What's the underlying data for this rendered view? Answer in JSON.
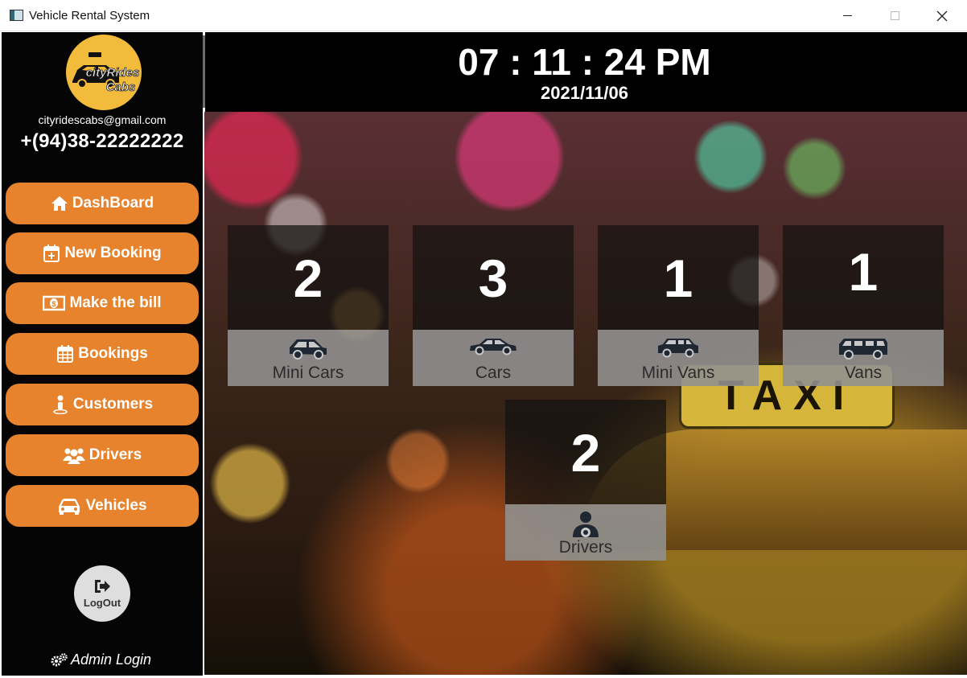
{
  "window": {
    "title": "Vehicle Rental System",
    "controls": [
      "minimize-icon",
      "maximize-icon",
      "close-icon"
    ]
  },
  "brand": {
    "logo_text_top": "cityRides",
    "logo_text_bottom": "Cabs",
    "email": "cityridescabs@gmail.com",
    "phone": "+(94)38-22222222"
  },
  "nav": {
    "items": [
      {
        "label": "DashBoard",
        "icon": "home-icon"
      },
      {
        "label": "New Booking",
        "icon": "calendar-plus-icon"
      },
      {
        "label": "Make the bill",
        "icon": "money-bill-icon"
      },
      {
        "label": "Bookings",
        "icon": "calendar-icon"
      },
      {
        "label": "Customers",
        "icon": "person-icon"
      },
      {
        "label": "Drivers",
        "icon": "users-icon"
      },
      {
        "label": "Vehicles",
        "icon": "car-icon"
      }
    ]
  },
  "logout": {
    "label": "LogOut",
    "icon": "sign-out-icon"
  },
  "admin": {
    "label": "Admin Login",
    "icon": "gears-icon"
  },
  "header": {
    "time": "07 : 11 : 24 PM",
    "date": "2021/11/06"
  },
  "background": {
    "sign_text": "TAXI"
  },
  "stats": {
    "mini_cars": {
      "count": "2",
      "label": "Mini Cars",
      "icon": "hatchback-icon"
    },
    "cars": {
      "count": "3",
      "label": "Cars",
      "icon": "sedan-icon"
    },
    "mini_vans": {
      "count": "1",
      "label": "Mini Vans",
      "icon": "suv-icon"
    },
    "vans": {
      "count": "1",
      "label": "Vans",
      "icon": "van-icon"
    },
    "drivers": {
      "count": "2",
      "label": "Drivers",
      "icon": "driver-icon"
    }
  },
  "colors": {
    "accent": "#e6832c",
    "sidebar_bg": "#050505",
    "header_bg": "#000000",
    "logo_bg": "#f3bb3b"
  }
}
